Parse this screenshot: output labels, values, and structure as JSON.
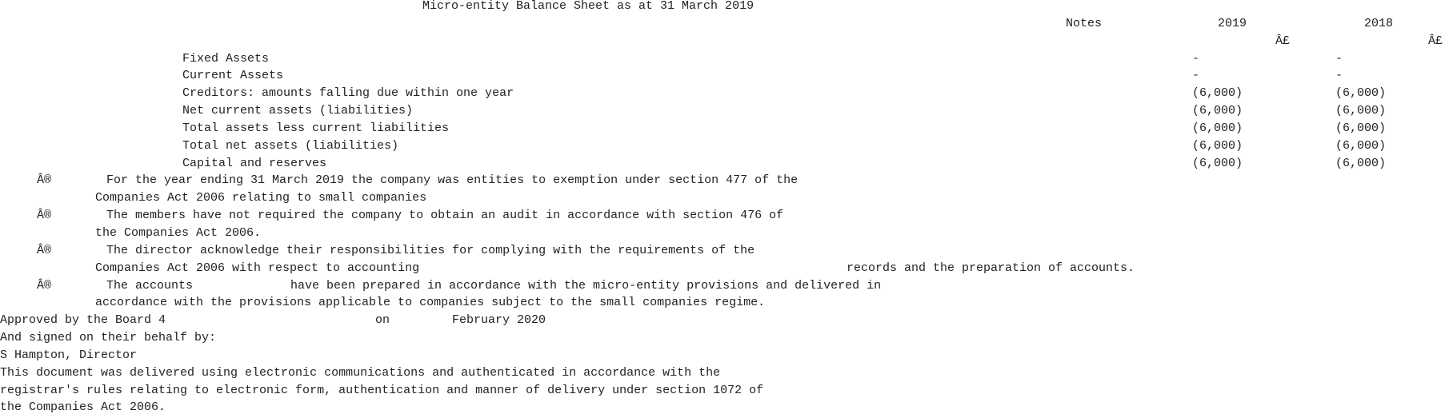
{
  "title": "Micro-entity Balance Sheet as at 31 March 2019",
  "header": {
    "notes": "Notes",
    "year_current": "2019",
    "year_prior": "2018",
    "currency_current": "Â£",
    "currency_prior": "Â£"
  },
  "rows": [
    {
      "label": "Fixed Assets",
      "v2019": "-",
      "v2018": "-"
    },
    {
      "label": "Current Assets",
      "v2019": "-",
      "v2018": "-"
    },
    {
      "label": "Creditors: amounts falling due within one year",
      "v2019": "(6,000)",
      "v2018": "(6,000)"
    },
    {
      "label": "Net current assets (liabilities)",
      "v2019": "(6,000)",
      "v2018": "(6,000)"
    },
    {
      "label": "Total assets less current liabilities",
      "v2019": "(6,000)",
      "v2018": "(6,000)"
    },
    {
      "label": "Total net assets (liabilities)",
      "v2019": "(6,000)",
      "v2018": "(6,000)"
    },
    {
      "label": "Capital and reserves",
      "v2019": "(6,000)",
      "v2018": "(6,000)"
    }
  ],
  "bullet_symbol": "Â®",
  "statements": [
    {
      "line1": "For the year ending 31 March 2019 the company was entities to exemption under section 477 of the",
      "line2": "Companies Act 2006 relating to small companies"
    },
    {
      "line1": "The members have not required the company to obtain an audit in accordance with section 476 of",
      "line2": "the Companies Act 2006."
    },
    {
      "line1": "The director acknowledge their responsibilities for complying with the requirements of the",
      "line2": "Companies Act 2006 with respect to accounting",
      "line2b": "records and the preparation of accounts."
    },
    {
      "line1": "The accounts",
      "line1b": "have been prepared in accordance with the micro-entity provisions and delivered in",
      "line2": "accordance with the provisions applicable to companies subject to the small companies regime."
    }
  ],
  "approval": {
    "prefix": "Approved by the Board 4",
    "on": "on",
    "date": "February 2020",
    "signed": "And signed on their behalf by:",
    "signatory": "S Hampton, Director"
  },
  "footer": [
    "This document was delivered using electronic communications and authenticated in accordance with the",
    "registrar's rules relating to electronic form, authentication and manner of delivery under section 1072 of",
    "the Companies Act 2006."
  ]
}
